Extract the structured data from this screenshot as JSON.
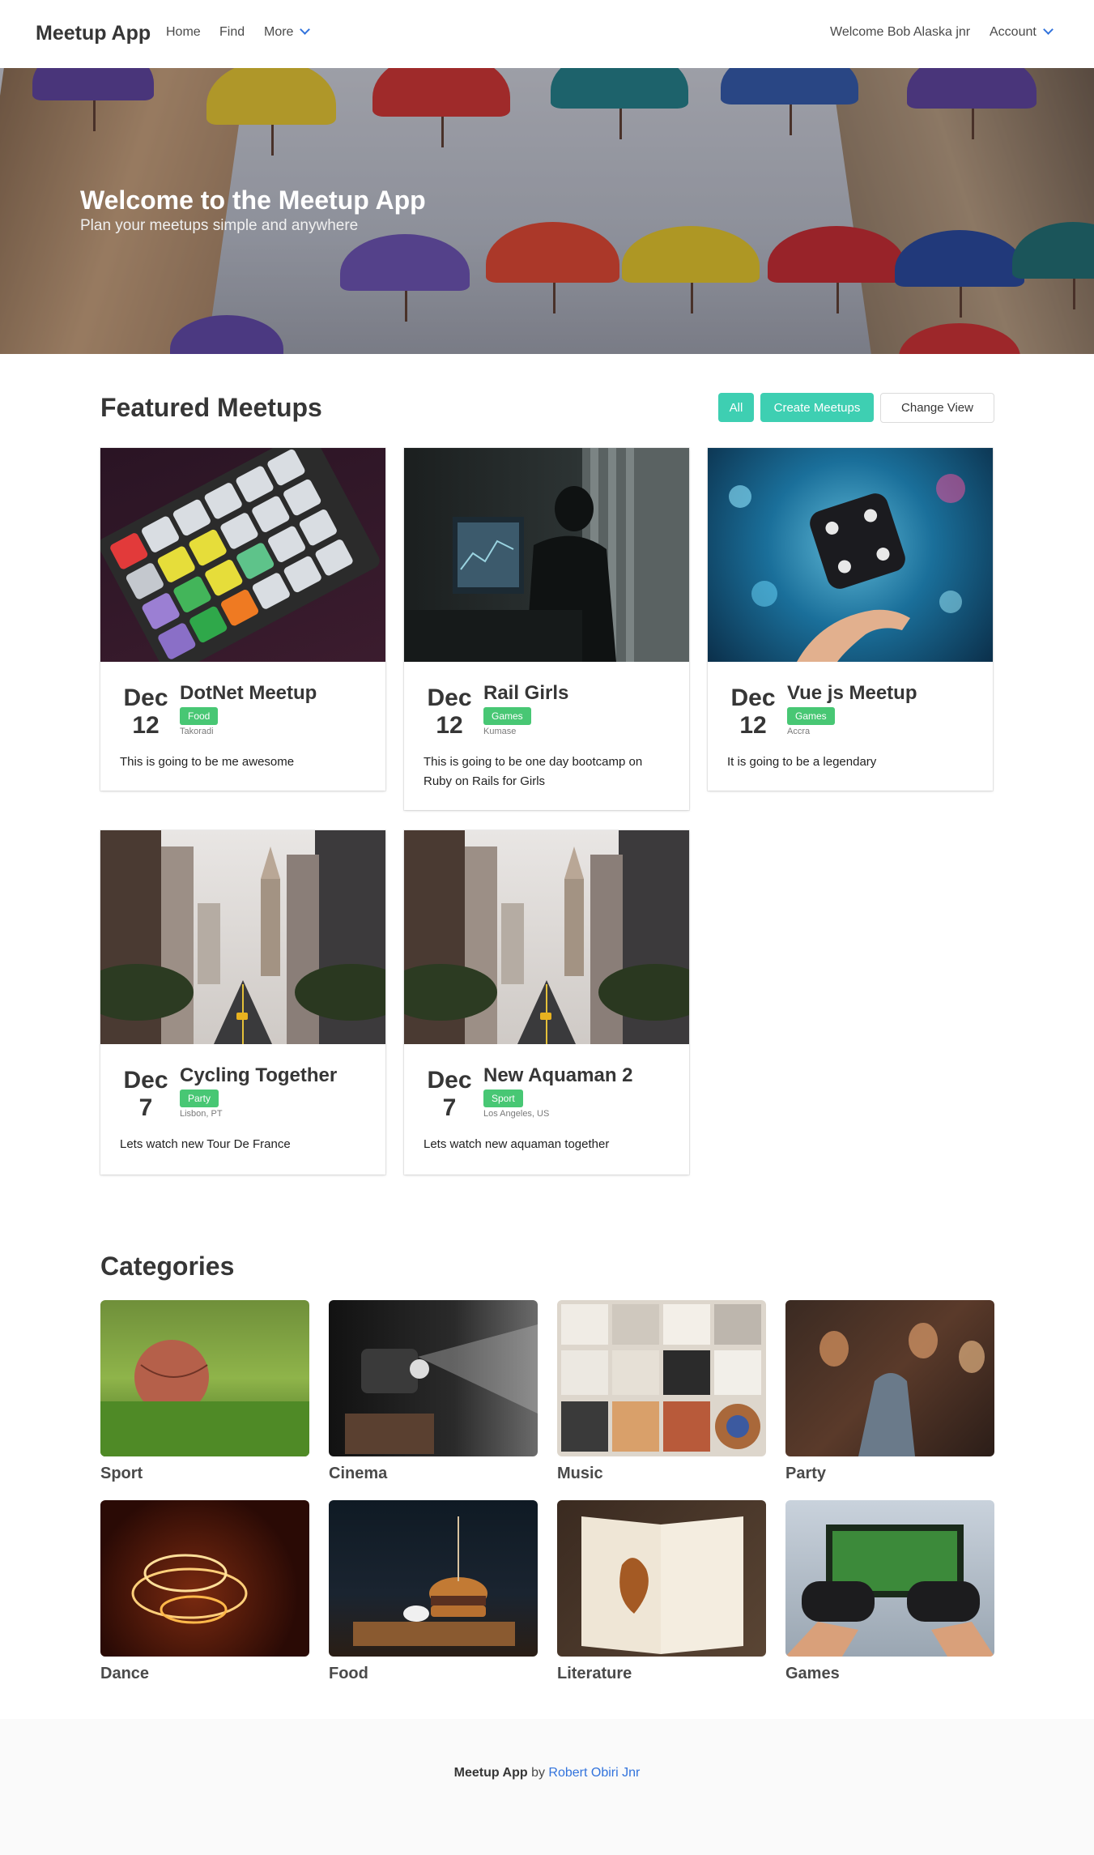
{
  "nav": {
    "brand": "Meetup App",
    "links": [
      "Home",
      "Find",
      "More"
    ],
    "welcome": "Welcome Bob Alaska jnr",
    "account": "Account"
  },
  "hero": {
    "title": "Welcome to the Meetup App",
    "subtitle": "Plan your meetups simple and anywhere"
  },
  "featured": {
    "title": "Featured Meetups",
    "buttons": {
      "all": "All",
      "create": "Create Meetups",
      "change_view": "Change View"
    },
    "meetups": [
      {
        "month": "Dec",
        "day": "12",
        "title": "DotNet Meetup",
        "tag": "Food",
        "location": "Takoradi",
        "description": "This is going to be me awesome"
      },
      {
        "month": "Dec",
        "day": "12",
        "title": "Rail Girls",
        "tag": "Games",
        "location": "Kumase",
        "description": "This is going to be one day bootcamp on Ruby on Rails for Girls"
      },
      {
        "month": "Dec",
        "day": "12",
        "title": "Vue js Meetup",
        "tag": "Games",
        "location": "Accra",
        "description": "It is going to be a legendary"
      },
      {
        "month": "Dec",
        "day": "7",
        "title": "Cycling Together",
        "tag": "Party",
        "location": "Lisbon, PT",
        "description": "Lets watch new Tour De France"
      },
      {
        "month": "Dec",
        "day": "7",
        "title": "New Aquaman 2",
        "tag": "Sport",
        "location": "Los Angeles, US",
        "description": "Lets watch new aquaman together"
      }
    ]
  },
  "categories": {
    "title": "Categories",
    "items": [
      "Sport",
      "Cinema",
      "Music",
      "Party",
      "Dance",
      "Food",
      "Literature",
      "Games"
    ]
  },
  "footer": {
    "brand": "Meetup App",
    "by": "by",
    "author": "Robert Obiri Jnr"
  },
  "colors": {
    "accent_teal": "#3ecfb2",
    "tag_green": "#48c774",
    "link_blue": "#3273dc"
  }
}
